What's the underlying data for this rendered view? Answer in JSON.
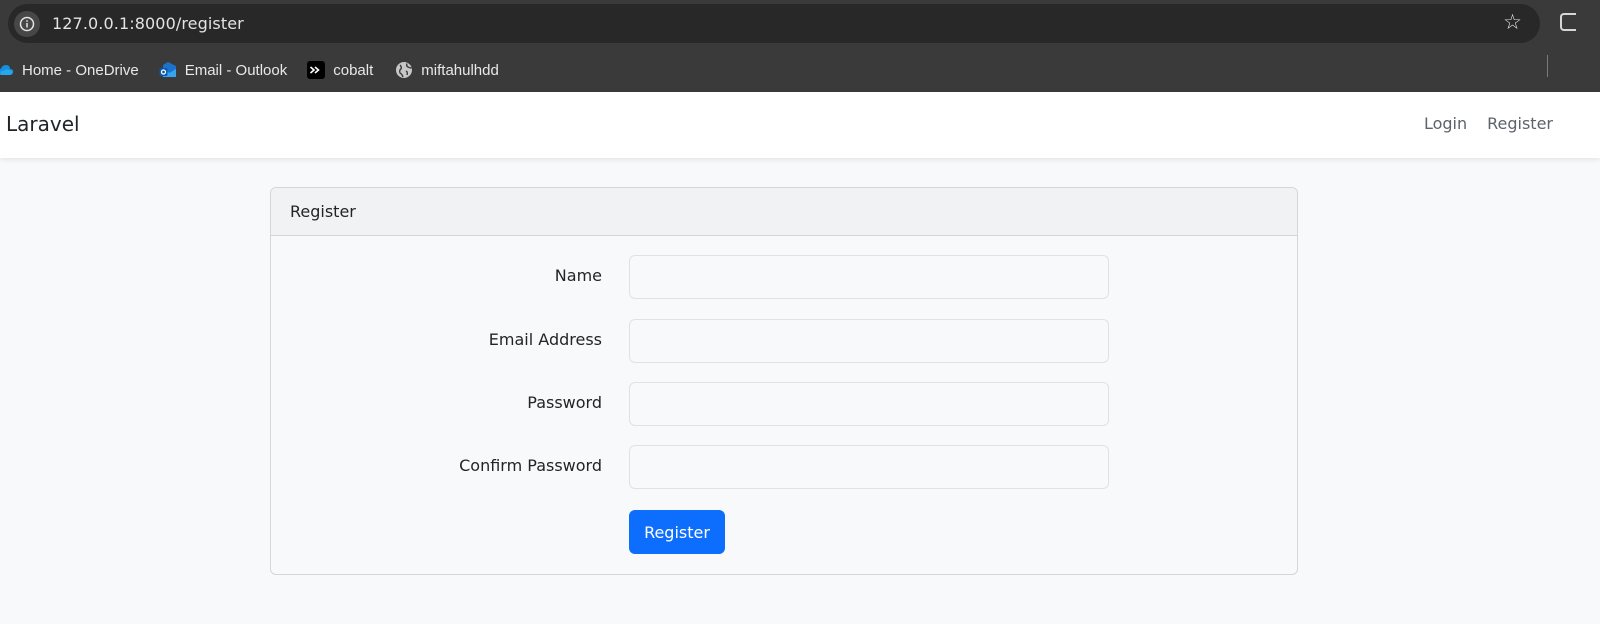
{
  "browser": {
    "url": "127.0.0.1:8000/register",
    "bookmarks": [
      {
        "label": "Home - OneDrive",
        "icon": "cloud-icon"
      },
      {
        "label": "Email - Outlook",
        "icon": "outlook-icon"
      },
      {
        "label": "cobalt",
        "icon": "terminal-icon"
      },
      {
        "label": "miftahulhdd",
        "icon": "globe-icon"
      }
    ]
  },
  "navbar": {
    "brand": "Laravel",
    "login": "Login",
    "register": "Register"
  },
  "card": {
    "header": "Register",
    "fields": [
      {
        "label": "Name",
        "value": ""
      },
      {
        "label": "Email Address",
        "value": ""
      },
      {
        "label": "Password",
        "value": ""
      },
      {
        "label": "Confirm Password",
        "value": ""
      }
    ],
    "submit": "Register"
  },
  "colors": {
    "primary": "#0d6efd",
    "chrome": "#3a3a3a",
    "page_bg": "#f8f9fa"
  }
}
